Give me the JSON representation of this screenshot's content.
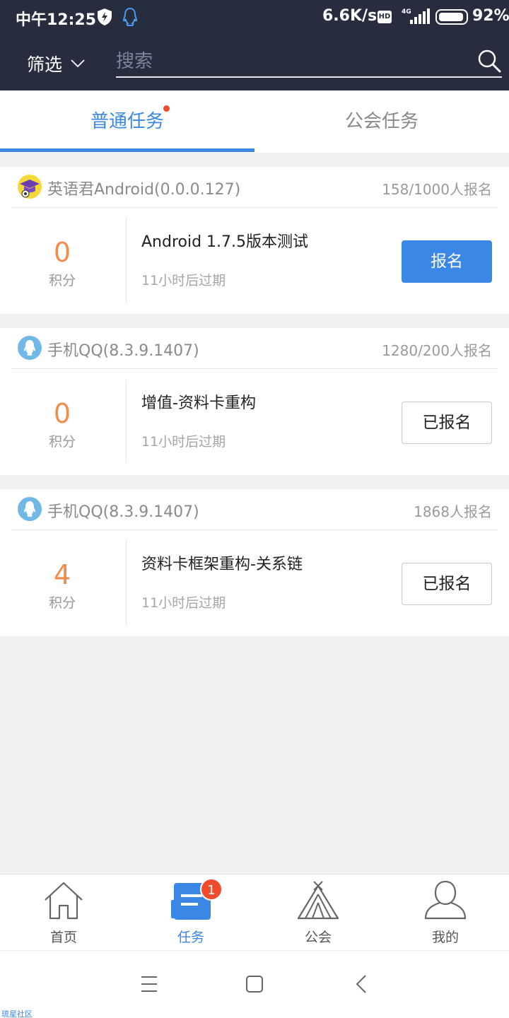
{
  "status_bar": {
    "time": "中午12:25",
    "network_speed": "6.6K/s",
    "hd_label": "HD",
    "battery_percent": "92%",
    "icons": [
      "shield-flash-icon",
      "qq-icon",
      "signal-4g-icon",
      "battery-icon"
    ]
  },
  "header": {
    "filter_label": "筛选",
    "search_placeholder": "搜索",
    "search_value": ""
  },
  "tabs": [
    {
      "label": "普通任务",
      "active": true,
      "has_dot": true
    },
    {
      "label": "公会任务",
      "active": false,
      "has_dot": false
    }
  ],
  "tasks": [
    {
      "app_name": "英语君Android(0.0.0.127)",
      "app_icon": "graduation-cap-icon",
      "signup_count": "158/1000人报名",
      "points": "0",
      "points_unit": "积分",
      "title": "Android 1.7.5版本测试",
      "expiry": "11小时后过期",
      "button_label": "报名",
      "button_style": "primary"
    },
    {
      "app_name": "手机QQ(8.3.9.1407)",
      "app_icon": "qq-penguin-icon",
      "signup_count": "1280/200人报名",
      "points": "0",
      "points_unit": "积分",
      "title": "增值-资料卡重构",
      "expiry": "11小时后过期",
      "button_label": "已报名",
      "button_style": "ghost"
    },
    {
      "app_name": "手机QQ(8.3.9.1407)",
      "app_icon": "qq-penguin-icon",
      "signup_count": "1868人报名",
      "points": "4",
      "points_unit": "积分",
      "title": "资料卡框架重构-关系链",
      "expiry": "11小时后过期",
      "button_label": "已报名",
      "button_style": "ghost"
    }
  ],
  "bottom_nav": [
    {
      "label": "首页",
      "icon": "home-icon",
      "active": false
    },
    {
      "label": "任务",
      "icon": "task-icon",
      "active": true,
      "badge": "1"
    },
    {
      "label": "公会",
      "icon": "tent-icon",
      "active": false
    },
    {
      "label": "我的",
      "icon": "profile-icon",
      "active": false
    }
  ],
  "watermark": "琉星社区",
  "colors": {
    "header_bg": "#272c3f",
    "accent": "#3a87e6",
    "points": "#f08c4c",
    "badge": "#f04b2c"
  }
}
